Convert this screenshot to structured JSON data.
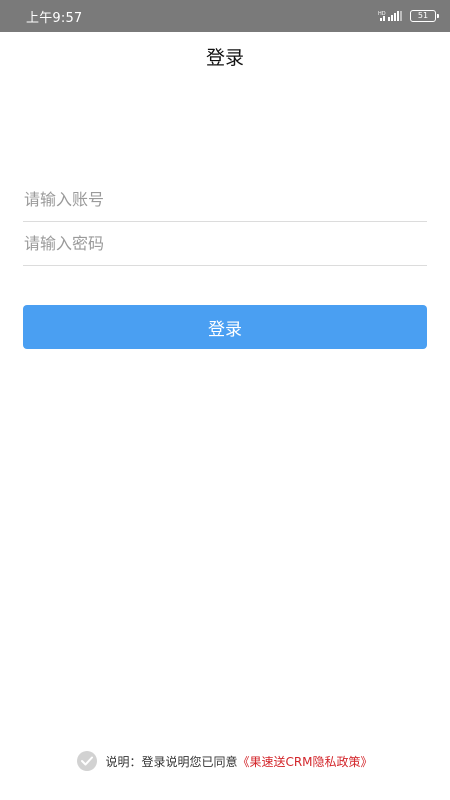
{
  "status_bar": {
    "time": "上午9:57",
    "battery_level": "51",
    "icons": [
      "signal-icon",
      "battery-icon"
    ]
  },
  "nav": {
    "title": "登录"
  },
  "form": {
    "account_placeholder": "请输入账号",
    "account_value": "",
    "password_placeholder": "请输入密码",
    "password_value": "",
    "login_label": "登录"
  },
  "agreement": {
    "checked": true,
    "text": "说明：登录说明您已同意",
    "link_text": "《果速送CRM隐私政策》"
  },
  "colors": {
    "status_bar_bg": "#7a7a7a",
    "button_bg": "#4a9ff2",
    "link": "#d3262b",
    "check_bg": "#d2d2d2"
  }
}
